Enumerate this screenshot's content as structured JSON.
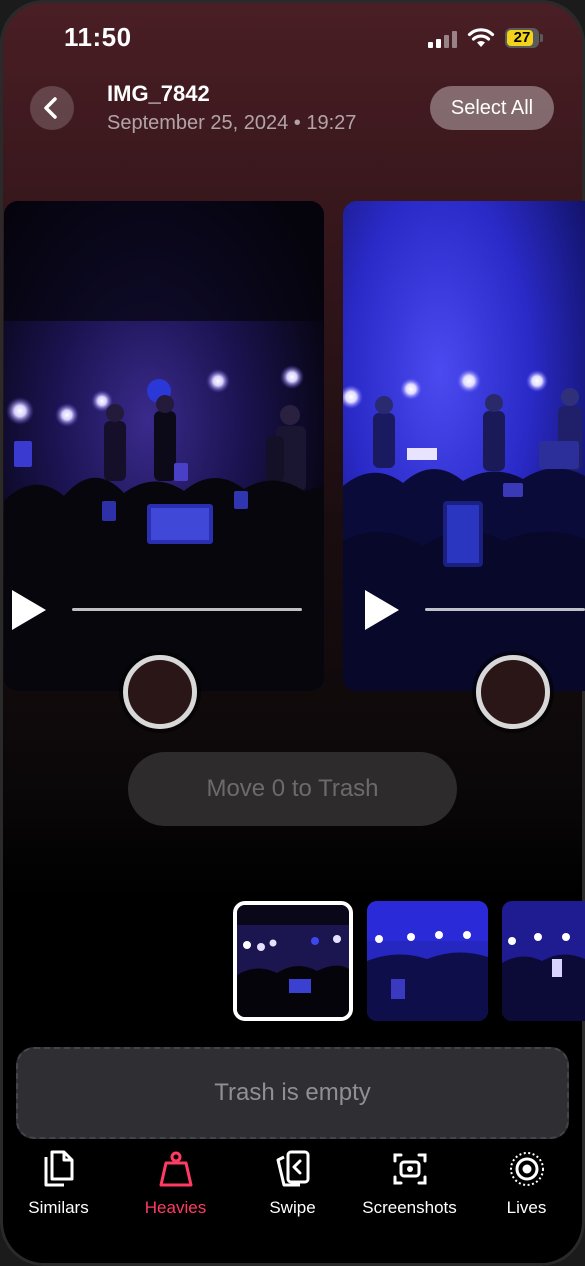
{
  "status_bar": {
    "time": "11:50",
    "battery": "27",
    "battery_color": "#f2d21b"
  },
  "header": {
    "title": "IMG_7842",
    "subtitle": "September 25, 2024 • 19:27",
    "select_all_label": "Select All",
    "back_icon": "chevron-left-icon"
  },
  "videos": [
    {
      "selected": false,
      "playback_progress": 0
    },
    {
      "selected": false,
      "playback_progress": 0
    }
  ],
  "move_button_label": "Move 0 to Trash",
  "thumbnail_strip": {
    "selected_index": 0,
    "count": 3
  },
  "trash_label": "Trash is empty",
  "tabs": [
    {
      "label": "Similars",
      "icon": "documents-icon",
      "active": false
    },
    {
      "label": "Heavies",
      "icon": "weight-icon",
      "active": true
    },
    {
      "label": "Swipe",
      "icon": "swipe-cards-icon",
      "active": false
    },
    {
      "label": "Screenshots",
      "icon": "screenshot-icon",
      "active": false
    },
    {
      "label": "Lives",
      "icon": "live-photo-icon",
      "active": false
    }
  ],
  "colors": {
    "accent": "#ff3b64",
    "header_bg": "#4a1e25"
  }
}
